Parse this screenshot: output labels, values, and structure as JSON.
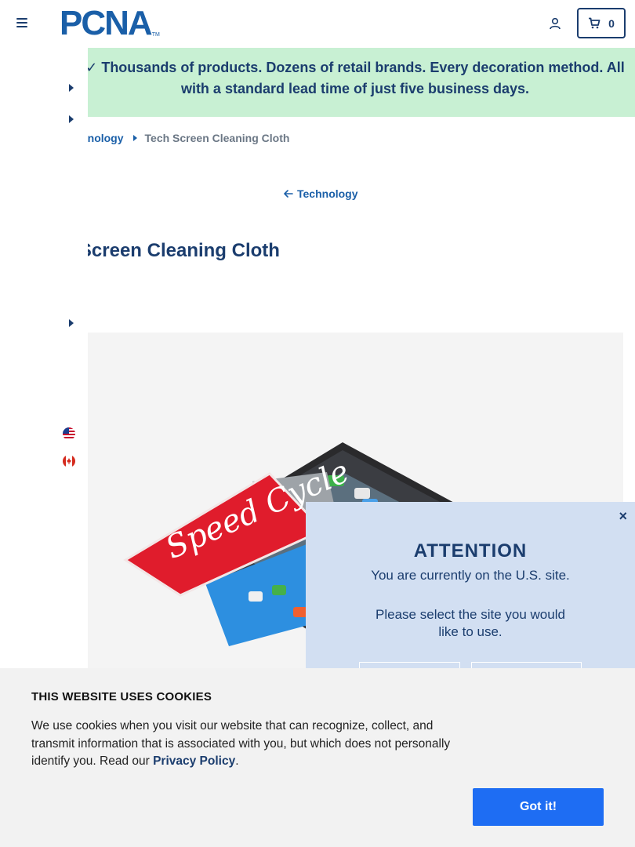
{
  "header": {
    "logo_text": "PCNA",
    "logo_tm": "TM",
    "cart_count": "0"
  },
  "banner": {
    "text": "✓ Thousands of products. Dozens of retail brands. Every decoration method. All\nwith a standard lead time of just five business days."
  },
  "breadcrumb": {
    "parent": "Technology",
    "current": "Tech Screen Cleaning Cloth"
  },
  "back_link": "Technology",
  "product": {
    "title": "Tech Screen Cleaning Cloth",
    "cloth_print": "Speed Cycle"
  },
  "attention": {
    "close": "×",
    "title": "ATTENTION",
    "line1": "You are currently on the U.S. site.",
    "line2": "Please select the site you would like to use."
  },
  "cookies": {
    "title": "THIS WEBSITE USES COOKIES",
    "body": "We use cookies when you visit our website that can recognize, collect, and transmit information that is associated with you, but which does not personally identify you. Read our ",
    "policy_link": "Privacy Policy",
    "period": ".",
    "accept": "Got it!"
  },
  "icons": {
    "menu": "hamburger-icon",
    "account": "user-icon",
    "cart": "cart-icon",
    "flags": [
      "us-flag-icon",
      "canada-flag-icon"
    ]
  },
  "colors": {
    "brand_navy": "#1b3d6e",
    "brand_blue": "#1a5fa8",
    "banner_green": "#c8f0d3",
    "modal_blue": "#d2dff2",
    "cookie_button": "#1e6df3"
  }
}
